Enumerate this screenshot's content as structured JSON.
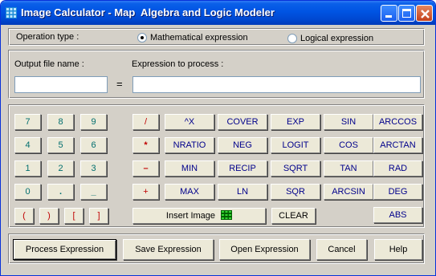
{
  "window": {
    "title": "Image Calculator - Map  Algebra and Logic Modeler"
  },
  "operation": {
    "label": "Operation type :",
    "math_label": "Mathematical expression",
    "logic_label": "Logical expression",
    "selected": "Mathematical expression"
  },
  "output": {
    "label": "Output file name :",
    "value": "",
    "equals": "="
  },
  "expression": {
    "label": "Expression to process :",
    "value": ""
  },
  "keypad": {
    "digits": [
      "7",
      "8",
      "9",
      "4",
      "5",
      "6",
      "1",
      "2",
      "3",
      "0",
      "."
    ],
    "minus": "_",
    "brackets": [
      "(",
      ")",
      "[",
      "]"
    ]
  },
  "operators": [
    "/",
    "*",
    "–",
    "+"
  ],
  "functions": {
    "col1": [
      "^X",
      "NRATIO",
      "MIN",
      "MAX"
    ],
    "col2": [
      "COVER",
      "NEG",
      "RECIP",
      "LN"
    ],
    "col3": [
      "EXP",
      "LOGIT",
      "SQRT",
      "SQR"
    ],
    "col4": [
      "SIN",
      "COS",
      "TAN",
      "ARCSIN"
    ],
    "col5": [
      "ARCCOS",
      "ARCTAN",
      "RAD",
      "DEG",
      "ABS"
    ]
  },
  "insert_image": "Insert Image",
  "clear": "CLEAR",
  "bottom": {
    "process": "Process Expression",
    "save": "Save Expression",
    "open": "Open Expression",
    "cancel": "Cancel",
    "help": "Help"
  },
  "colors": {
    "title_blue": "#0054e3",
    "number_teal": "#006e6e",
    "operator_red": "#c00000",
    "function_navy": "#00008b",
    "grid_icon_green": "#00a000"
  }
}
